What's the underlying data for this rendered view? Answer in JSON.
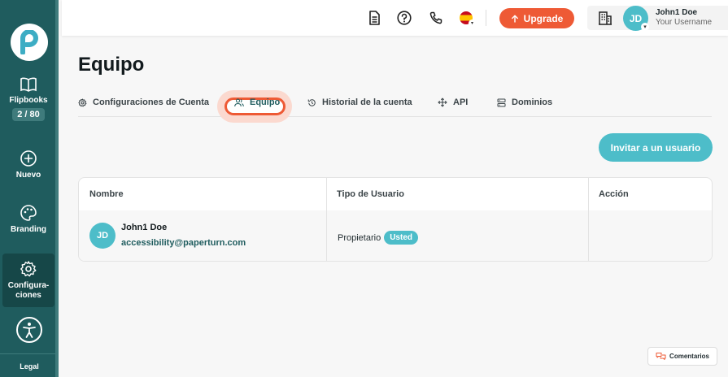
{
  "colors": {
    "sidebar": "#1f5c5e",
    "accent": "#ee5a35",
    "teal": "#4dbdc9"
  },
  "sidebar": {
    "items": [
      {
        "label": "Flipbooks",
        "count": "2 / 80",
        "icon": "book-icon"
      },
      {
        "label": "Nuevo",
        "icon": "plus-circle-icon"
      },
      {
        "label": "Branding",
        "icon": "palette-icon"
      },
      {
        "label": "Configura-\nciones",
        "icon": "gear-icon",
        "active": true
      }
    ],
    "legal": "Legal"
  },
  "topbar": {
    "upgrade_label": "Upgrade",
    "user_initials": "JD",
    "user_name": "John1 Doe",
    "user_subtitle": "Your Username"
  },
  "page": {
    "title": "Equipo",
    "tabs": [
      {
        "label": "Configuraciones de Cuenta",
        "icon": "gear-icon"
      },
      {
        "label": "Equipo",
        "icon": "users-icon",
        "active": true
      },
      {
        "label": "Historial de la cuenta",
        "icon": "history-icon"
      },
      {
        "label": "API",
        "icon": "move-icon"
      },
      {
        "label": "Dominios",
        "icon": "server-icon"
      }
    ],
    "invite_label": "Invitar a un usuario"
  },
  "table": {
    "headers": [
      "Nombre",
      "Tipo de Usuario",
      "Acción"
    ],
    "rows": [
      {
        "initials": "JD",
        "name": "John1 Doe",
        "email": "accessibility@paperturn.com",
        "type": "Propietario",
        "badge": "Usted"
      }
    ]
  },
  "feedback_label": "Comentarios"
}
